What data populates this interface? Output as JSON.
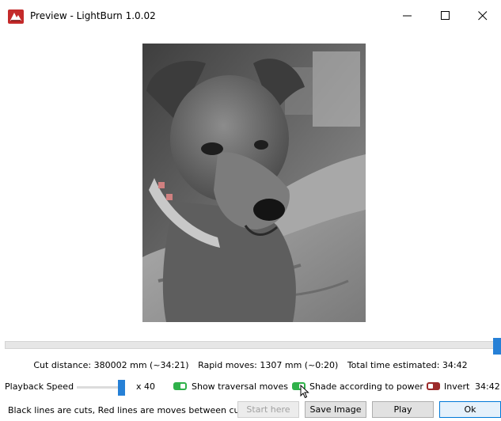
{
  "window": {
    "title": "Preview - LightBurn 1.0.02",
    "minimize_icon": "minimize-icon",
    "maximize_icon": "maximize-icon",
    "close_icon": "close-icon"
  },
  "preview": {
    "image_description_icon": "photo-preview",
    "playback_progress": 1.0
  },
  "stats": {
    "cut_distance": "Cut distance: 380002 mm (~34:21)",
    "rapid_moves": "Rapid moves: 1307 mm (~0:20)",
    "total_time": "Total time estimated: 34:42"
  },
  "controls": {
    "playback_label": "Playback Speed",
    "speed_value": "x 40",
    "show_traversal_label": "Show traversal moves",
    "show_traversal_on": true,
    "shade_label": "Shade according to power",
    "shade_on": true,
    "invert_label": "Invert",
    "invert_on": false,
    "time_readout": "34:42"
  },
  "footer": {
    "note": "Black lines are cuts, Red lines are moves between cuts",
    "start_here": "Start here",
    "save_image": "Save Image",
    "play": "Play",
    "ok": "Ok"
  },
  "colors": {
    "accent": "#2680d6",
    "toggle_on": "#2fb14a",
    "toggle_off": "#9c2a2a"
  }
}
